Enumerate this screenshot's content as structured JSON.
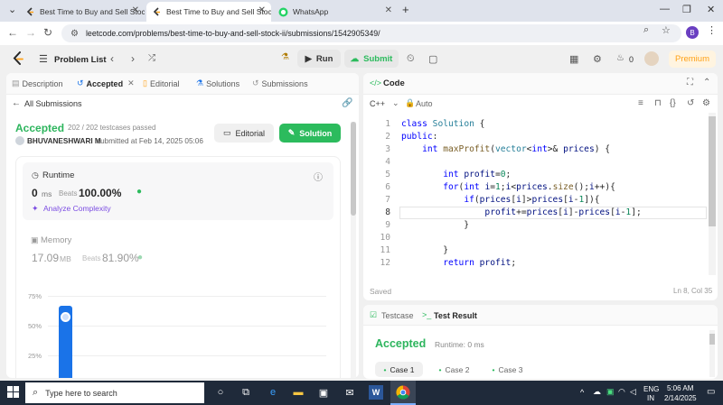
{
  "browser": {
    "tabs": [
      {
        "label": "Best Time to Buy and Sell Stock",
        "active": false
      },
      {
        "label": "Best Time to Buy and Sell Stock",
        "active": true
      },
      {
        "label": "WhatsApp",
        "active": false
      }
    ],
    "url": "leetcode.com/problems/best-time-to-buy-and-sell-stock-ii/submissions/1542905349/",
    "profile_initial": "B"
  },
  "nav": {
    "problem_list": "Problem List",
    "run": "Run",
    "submit": "Submit",
    "streak": "0",
    "premium": "Premium"
  },
  "left": {
    "tabs": {
      "description": "Description",
      "accepted": "Accepted",
      "editorial": "Editorial",
      "solutions": "Solutions",
      "submissions": "Submissions"
    },
    "all_submissions": "All Submissions",
    "status": "Accepted",
    "testcases": "202 / 202 testcases passed",
    "user": "BHUVANESHWARI M",
    "submitted": "submitted at Feb 14, 2025 05:06",
    "editorial_btn": "Editorial",
    "solution_btn": "Solution",
    "runtime": {
      "label": "Runtime",
      "value": "0",
      "unit": "ms",
      "beats_label": "Beats",
      "beats_value": "100.00%",
      "analyze": "Analyze Complexity"
    },
    "memory": {
      "label": "Memory",
      "value": "17.09",
      "unit": "MB",
      "beats_label": "Beats",
      "beats_value": "81.90%"
    },
    "chart_axis": [
      "75%",
      "50%",
      "25%"
    ]
  },
  "code": {
    "title": "Code",
    "language": "C++",
    "mode": "Auto",
    "saved": "Saved",
    "cursor": "Ln 8, Col 35",
    "line_numbers": [
      "1",
      "2",
      "3",
      "4",
      "5",
      "6",
      "7",
      "8",
      "9",
      "10",
      "11",
      "12"
    ]
  },
  "test": {
    "testcase_tab": "Testcase",
    "result_tab": "Test Result",
    "status": "Accepted",
    "runtime": "Runtime: 0 ms",
    "cases": [
      "Case 1",
      "Case 2",
      "Case 3"
    ]
  },
  "taskbar": {
    "search_placeholder": "Type here to search",
    "lang": "ENG",
    "region": "IN",
    "time": "5:06 AM",
    "date": "2/14/2025"
  },
  "colors": {
    "accent_green": "#2cbb5d",
    "accepted_green": "#2db55d",
    "premium_orange": "#ffa116",
    "bar_blue": "#1a73e8"
  }
}
